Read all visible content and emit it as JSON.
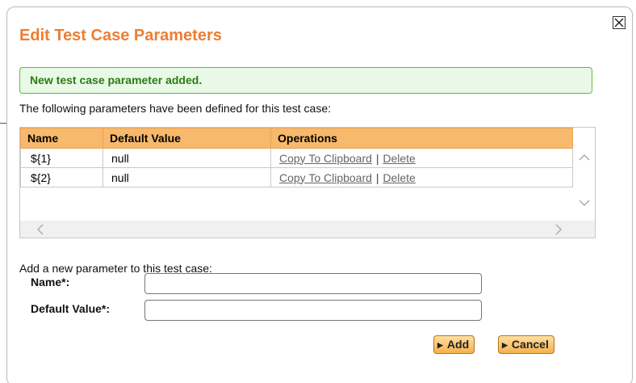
{
  "dialog": {
    "title": "Edit Test Case Parameters",
    "close_icon": "close-x-icon"
  },
  "notice": {
    "text": "New test case parameter added."
  },
  "intro_text": "The following parameters have been defined for this test case:",
  "table": {
    "headers": [
      "Name",
      "Default Value",
      "Operations"
    ],
    "rows": [
      {
        "name": "${1}",
        "default_value": "null",
        "copy_label": "Copy To Clipboard",
        "separator": "|",
        "delete_label": "Delete"
      },
      {
        "name": "${2}",
        "default_value": "null",
        "copy_label": "Copy To Clipboard",
        "separator": "|",
        "delete_label": "Delete"
      }
    ]
  },
  "scrollbars": {
    "up_icon": "chevron-up-icon",
    "down_icon": "chevron-down-icon",
    "left_icon": "chevron-left-icon",
    "right_icon": "chevron-right-icon"
  },
  "add_form": {
    "heading": "Add a new parameter to this test case:",
    "name_label": "Name*:",
    "name_value": "",
    "default_label": "Default Value*:",
    "default_value": ""
  },
  "buttons": {
    "add_label": "Add",
    "cancel_label": "Cancel",
    "button_icon": "play-triangle-icon"
  },
  "colors": {
    "title": "#ef7d31",
    "header_bg": "#f7b96b",
    "notice_bg": "#e8f9e6",
    "notice_border": "#5ebd3e",
    "notice_text": "#2c7a12",
    "button_bg": "#f6b14a"
  }
}
